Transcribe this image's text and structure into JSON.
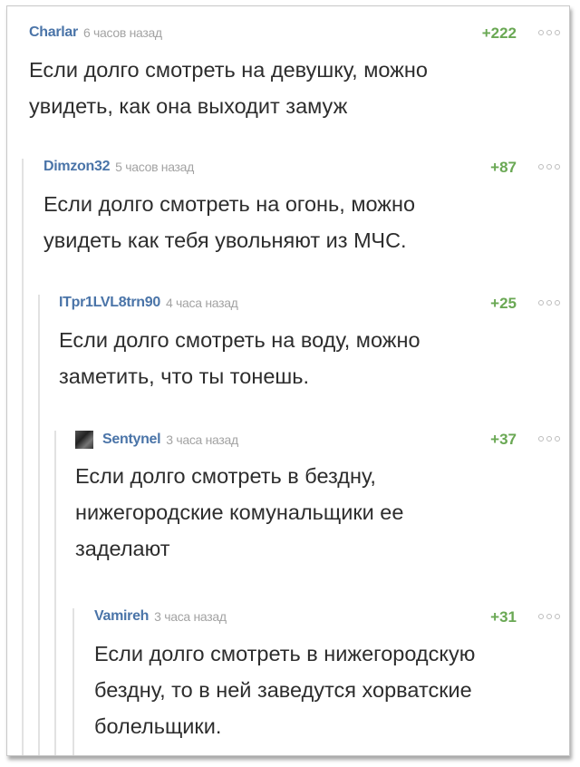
{
  "comments": [
    {
      "author": "Charlar",
      "time": "6 часов назад",
      "rating": "+222",
      "text": "Если долго смотреть на девушку, можно\nувидеть, как она выходит замуж"
    },
    {
      "author": "Dimzon32",
      "time": "5 часов назад",
      "rating": "+87",
      "text": "Если долго смотреть на огонь, можно\nувидеть как тебя увольняют из МЧС."
    },
    {
      "author": "ITpr1LVL8trn90",
      "time": "4 часа назад",
      "rating": "+25",
      "text": "Если долго смотреть на воду, можно\nзаметить, что ты тонешь."
    },
    {
      "author": "Sentynel",
      "time": "3 часа назад",
      "rating": "+37",
      "text": "Если долго смотреть в бездну,\nнижегородские комунальщики ее\nзаделают"
    },
    {
      "author": "Vamireh",
      "time": "3 часа назад",
      "rating": "+31",
      "text": "Если долго смотреть в нижегородскую\nбездну, то в ней заведутся хорватские\nболельщики."
    }
  ]
}
